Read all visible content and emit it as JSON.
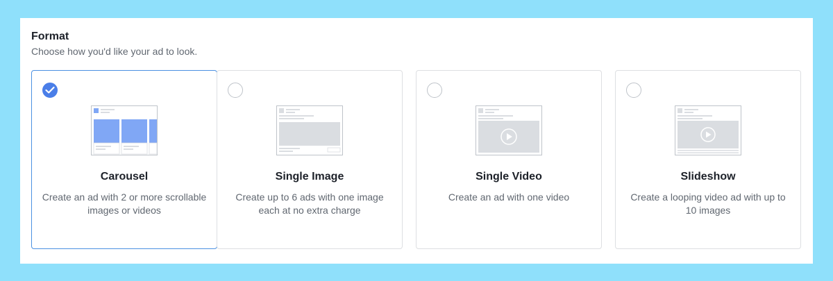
{
  "format": {
    "title": "Format",
    "subtitle": "Choose how you'd like your ad to look."
  },
  "cards": [
    {
      "title": "Carousel",
      "description": "Create an ad with 2 or more scrollable images or videos",
      "selected": true
    },
    {
      "title": "Single Image",
      "description": "Create up to 6 ads with one image each at no extra charge",
      "selected": false
    },
    {
      "title": "Single Video",
      "description": "Create an ad with one video",
      "selected": false
    },
    {
      "title": "Slideshow",
      "description": "Create a looping video ad with up to 10 images",
      "selected": false
    }
  ],
  "colors": {
    "accent": "#4a7ee8",
    "page_background": "#8fe0fb",
    "placeholder": "#dadde1",
    "carousel_image": "#80a7f5"
  }
}
